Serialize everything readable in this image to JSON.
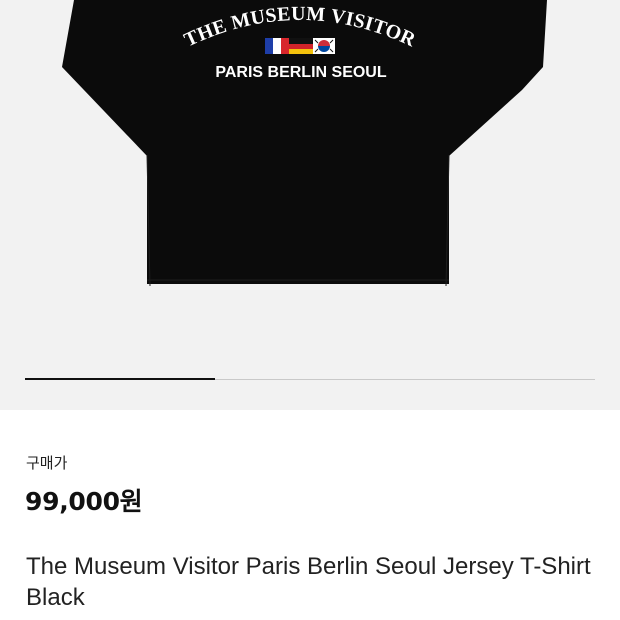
{
  "product_image": {
    "print_top_text": "THE MUSEUM VISITOR",
    "print_bottom_text": "PARIS BERLIN SEOUL",
    "flags": [
      "france-flag",
      "germany-flag",
      "korea-flag"
    ],
    "shirt_color": "#0b0b0b",
    "background_color": "#f2f2f2"
  },
  "carousel": {
    "progress": 0.333
  },
  "purchase": {
    "price_label": "구매가",
    "price": "99,000원"
  },
  "product": {
    "name": "The Museum Visitor Paris Berlin Seoul Jersey T-Shirt Black"
  }
}
